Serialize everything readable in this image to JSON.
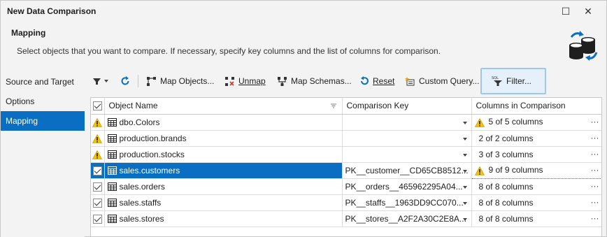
{
  "window": {
    "title": "New Data Comparison",
    "maximize_glyph": "☐",
    "close_glyph": "✕"
  },
  "header": {
    "title": "Mapping",
    "description": "Select objects that you want to compare. If necessary, specify key columns and the list of columns for comparison.",
    "icon": "database-compare-icon"
  },
  "nav": {
    "items": [
      {
        "label": "Source and Target"
      },
      {
        "label": "Options"
      },
      {
        "label": "Mapping"
      }
    ],
    "active_index": 2
  },
  "toolbar": {
    "map_objects": "Map Objects...",
    "unmap": "Unmap",
    "map_schemas": "Map Schemas...",
    "reset": "Reset",
    "custom_query": "Custom Query...",
    "filter": "Filter..."
  },
  "grid": {
    "headers": {
      "object_name": "Object Name",
      "comparison_key": "Comparison Key",
      "columns_in_comparison": "Columns in Comparison"
    },
    "rows": [
      {
        "status": "warning",
        "name": "dbo.Colors",
        "key": "",
        "columns": "5 of 5 columns",
        "columns_warning": true,
        "selected": false
      },
      {
        "status": "warning",
        "name": "production.brands",
        "key": "",
        "columns": "2 of 2 columns",
        "columns_warning": false,
        "selected": false
      },
      {
        "status": "warning",
        "name": "production.stocks",
        "key": "",
        "columns": "3 of 3 columns",
        "columns_warning": false,
        "selected": false
      },
      {
        "status": "checked",
        "name": "sales.customers",
        "key": "PK__customer__CD65CB8512...",
        "columns": "9 of 9 columns",
        "columns_warning": true,
        "selected": true
      },
      {
        "status": "checked",
        "name": "sales.orders",
        "key": "PK__orders__465962295A04...",
        "columns": "8 of 8 columns",
        "columns_warning": false,
        "selected": false
      },
      {
        "status": "checked",
        "name": "sales.staffs",
        "key": "PK__staffs__1963DD9CC070...",
        "columns": "8 of 8 columns",
        "columns_warning": false,
        "selected": false
      },
      {
        "status": "checked",
        "name": "sales.stores",
        "key": "PK__stores__A2F2A30C2E8A...",
        "columns": "8 of 8 columns",
        "columns_warning": false,
        "selected": false
      }
    ]
  },
  "colors": {
    "accent": "#0a6fc2",
    "warning": "#f5c400",
    "filter_highlight": "#9cc8ef"
  }
}
